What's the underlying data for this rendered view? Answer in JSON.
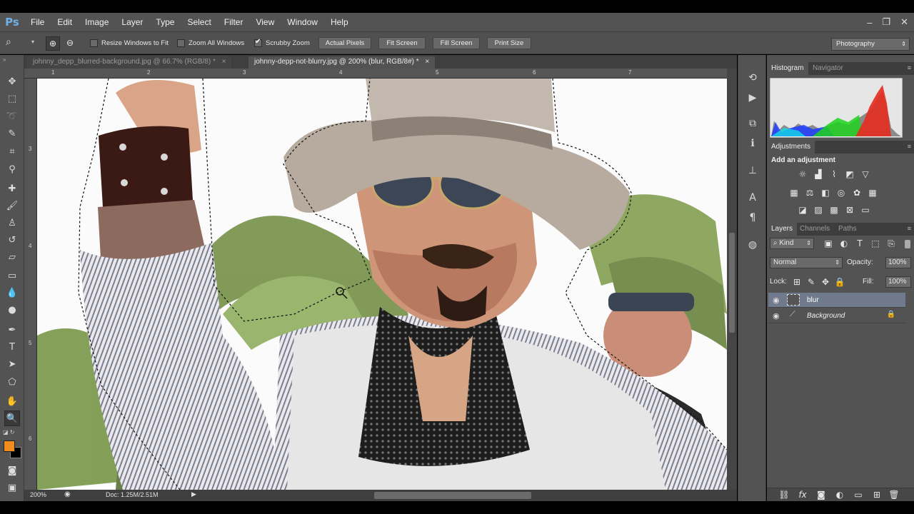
{
  "app": {
    "logo": "Ps"
  },
  "menu": [
    "File",
    "Edit",
    "Image",
    "Layer",
    "Type",
    "Select",
    "Filter",
    "View",
    "Window",
    "Help"
  ],
  "window_controls": {
    "minimize": "–",
    "restore": "❐",
    "close": "✕"
  },
  "options": {
    "resize_windows": "Resize Windows to Fit",
    "zoom_all_windows": "Zoom All Windows",
    "scrubby_zoom": "Scrubby Zoom",
    "actual_pixels": "Actual Pixels",
    "fit_screen": "Fit Screen",
    "fill_screen": "Fill Screen",
    "print_size": "Print Size",
    "workspace": "Photography",
    "checks": {
      "resize_windows": false,
      "zoom_all_windows": false,
      "scrubby_zoom": true
    }
  },
  "tabs": [
    {
      "label": "johnny_depp_blurred-background.jpg @ 66.7% (RGB/8) *",
      "active": false
    },
    {
      "label": "johnny-depp-not-blurry.jpg @ 200% (blur, RGB/8#) *",
      "active": true
    }
  ],
  "tab_close": "×",
  "rulers": {
    "top": [
      "1",
      "2",
      "3",
      "4",
      "5",
      "6",
      "7"
    ],
    "left": [
      "3",
      "4",
      "5",
      "6"
    ]
  },
  "status": {
    "zoom": "200%",
    "doc": "Doc: 1.25M/2.51M"
  },
  "panels": {
    "histogram_tab": "Histogram",
    "navigator_tab": "Navigator",
    "adjustments_tab": "Adjustments",
    "adjustments_hint": "Add an adjustment",
    "layers_tab": "Layers",
    "channels_tab": "Channels",
    "paths_tab": "Paths",
    "kind_filter": "Kind",
    "blend_mode": "Normal",
    "opacity_label": "Opacity:",
    "opacity_value": "100%",
    "lock_label": "Lock:",
    "fill_label": "Fill:",
    "fill_value": "100%"
  },
  "layers": [
    {
      "name": "blur",
      "selected": true
    },
    {
      "name": "Background",
      "selected": false,
      "locked": true
    }
  ],
  "colors": {
    "foreground": "#f28c1c",
    "background": "#000000",
    "panel": "#535353"
  }
}
